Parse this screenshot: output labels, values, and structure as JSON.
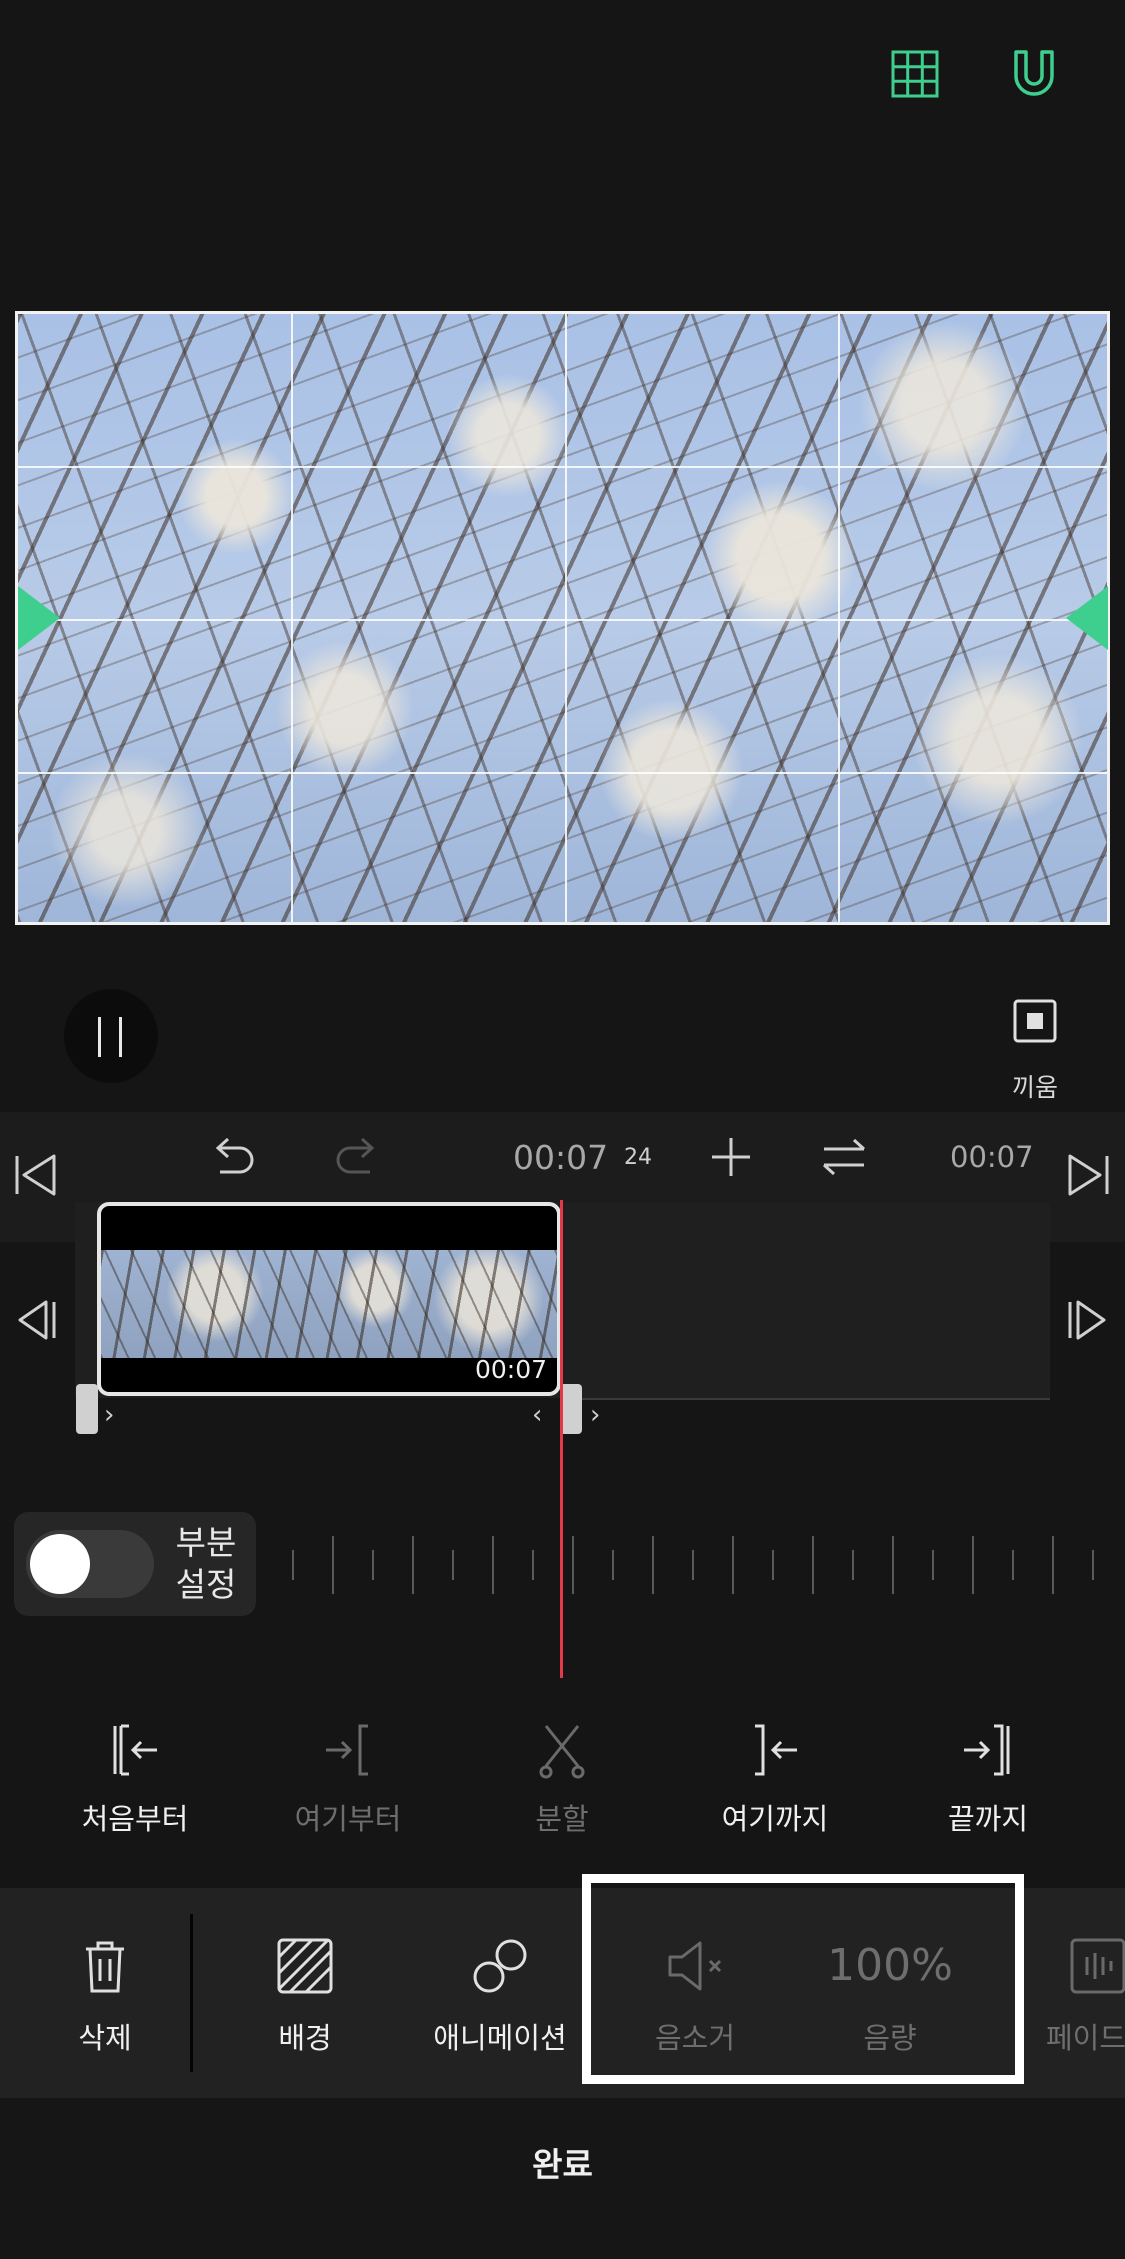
{
  "top_toolbar": {
    "grid_icon": "grid-icon",
    "magnet_icon": "magnet-icon"
  },
  "colors": {
    "accent": "#3ecf8e",
    "playhead": "#e23a4a",
    "highlight": "#ffffff"
  },
  "player": {
    "fit_label": "끼움"
  },
  "toolbar": {
    "current_time": "00:07",
    "current_frame": "24",
    "total_time": "00:07"
  },
  "clip": {
    "duration": "00:07"
  },
  "partial": {
    "label_line1": "부분",
    "label_line2": "설정",
    "enabled": false
  },
  "actions": [
    {
      "label": "처음부터",
      "enabled": true
    },
    {
      "label": "여기부터",
      "enabled": false
    },
    {
      "label": "분할",
      "enabled": false
    },
    {
      "label": "여기까지",
      "enabled": true
    },
    {
      "label": "끝까지",
      "enabled": true
    }
  ],
  "menu": {
    "delete": "삭제",
    "background": "배경",
    "animation": "애니메이션",
    "mute": "음소거",
    "volume_value": "100%",
    "volume": "음량",
    "fade": "페이드"
  },
  "done_label": "완료"
}
